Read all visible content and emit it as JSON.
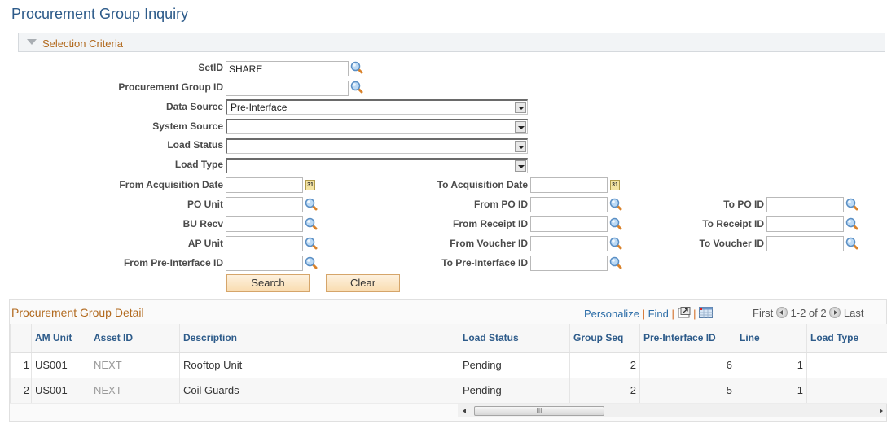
{
  "page": {
    "title": "Procurement Group Inquiry"
  },
  "selection": {
    "header": "Selection Criteria",
    "setid": {
      "label": "SetID",
      "value": "SHARE"
    },
    "proc_group_id": {
      "label": "Procurement Group ID",
      "value": ""
    },
    "data_source": {
      "label": "Data Source",
      "value": "Pre-Interface"
    },
    "system_source": {
      "label": "System Source",
      "value": ""
    },
    "load_status": {
      "label": "Load Status",
      "value": ""
    },
    "load_type": {
      "label": "Load Type",
      "value": ""
    },
    "from_acq_date": {
      "label": "From Acquisition Date",
      "value": ""
    },
    "to_acq_date": {
      "label": "To Acquisition Date",
      "value": ""
    },
    "po_unit": {
      "label": "PO Unit",
      "value": ""
    },
    "from_po_id": {
      "label": "From PO ID",
      "value": ""
    },
    "to_po_id": {
      "label": "To PO ID",
      "value": ""
    },
    "bu_recv": {
      "label": "BU Recv",
      "value": ""
    },
    "from_receipt_id": {
      "label": "From Receipt ID",
      "value": ""
    },
    "to_receipt_id": {
      "label": "To Receipt ID",
      "value": ""
    },
    "ap_unit": {
      "label": "AP Unit",
      "value": ""
    },
    "from_voucher_id": {
      "label": "From Voucher ID",
      "value": ""
    },
    "to_voucher_id": {
      "label": "To Voucher ID",
      "value": ""
    },
    "from_preint_id": {
      "label": "From Pre-Interface ID",
      "value": ""
    },
    "to_preint_id": {
      "label": "To Pre-Interface ID",
      "value": ""
    },
    "search_label": "Search",
    "clear_label": "Clear",
    "calendar_glyph": "31"
  },
  "grid": {
    "title": "Procurement Group Detail",
    "personalize": "Personalize",
    "find": "Find",
    "sep": "|",
    "first": "First",
    "range": "1-2 of 2",
    "last": "Last",
    "columns": [
      "",
      "AM Unit",
      "Asset ID",
      "Description",
      "Load Status",
      "Group Seq",
      "Pre-Interface ID",
      "Line",
      "Load Type"
    ],
    "rows": [
      {
        "num": "1",
        "am_unit": "US001",
        "asset_id": "NEXT",
        "description": "Rooftop Unit",
        "load_status": "Pending",
        "group_seq": "2",
        "preint_id": "6",
        "line": "1",
        "load_type": ""
      },
      {
        "num": "2",
        "am_unit": "US001",
        "asset_id": "NEXT",
        "description": "Coil Guards",
        "load_status": "Pending",
        "group_seq": "2",
        "preint_id": "5",
        "line": "1",
        "load_type": ""
      }
    ],
    "scroll_grip": "III"
  }
}
